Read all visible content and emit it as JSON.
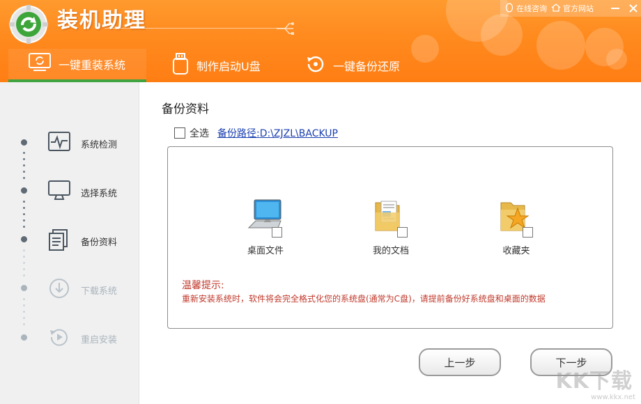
{
  "app": {
    "title": "装机助理"
  },
  "toplinks": {
    "consult": "在线咨询",
    "website": "官方网站"
  },
  "tabs": [
    {
      "label": "一键重装系统"
    },
    {
      "label": "制作启动U盘"
    },
    {
      "label": "一键备份还原"
    }
  ],
  "steps": [
    {
      "label": "系统检测",
      "state": "done"
    },
    {
      "label": "选择系统",
      "state": "done"
    },
    {
      "label": "备份资料",
      "state": "current"
    },
    {
      "label": "下载系统",
      "state": "pending"
    },
    {
      "label": "重启安装",
      "state": "pending"
    }
  ],
  "main": {
    "title": "备份资料",
    "select_all": "全选",
    "backup_path_label": "备份路径:",
    "backup_path": "D:\\ZJZL\\BACKUP"
  },
  "items": [
    {
      "label": "桌面文件"
    },
    {
      "label": "我的文档"
    },
    {
      "label": "收藏夹"
    }
  ],
  "tip": {
    "title": "温馨提示:",
    "text": "重新安装系统时，软件将会完全格式化您的系统盘(通常为C盘)，请提前备份好系统盘和桌面的数据"
  },
  "buttons": {
    "prev": "上一步",
    "next": "下一步"
  },
  "watermark": {
    "text": "www.kkx.net",
    "logo_text": "KK下载"
  },
  "colors": {
    "header": "#ff8a1e",
    "tab_active_underline": "#3fa33f",
    "tip": "#c0392b",
    "link": "#1a3fb0"
  }
}
